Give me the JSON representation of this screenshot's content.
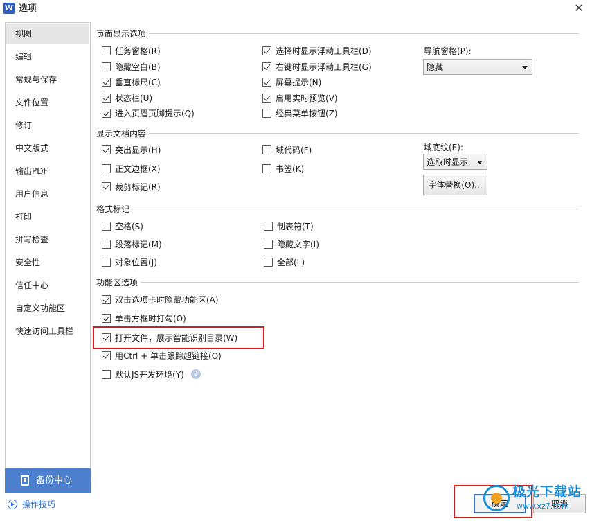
{
  "window": {
    "app_icon": "W",
    "title": "选项",
    "close": "✕"
  },
  "sidebar": {
    "items": [
      {
        "label": "视图",
        "active": true
      },
      {
        "label": "编辑"
      },
      {
        "label": "常规与保存"
      },
      {
        "label": "文件位置"
      },
      {
        "label": "修订"
      },
      {
        "label": "中文版式"
      },
      {
        "label": "输出PDF"
      },
      {
        "label": "用户信息"
      },
      {
        "label": "打印"
      },
      {
        "label": "拼写检查"
      },
      {
        "label": "安全性"
      },
      {
        "label": "信任中心"
      },
      {
        "label": "自定义功能区"
      },
      {
        "label": "快速访问工具栏"
      }
    ],
    "backup_label": "备份中心",
    "tips_label": "操作技巧"
  },
  "sections": {
    "page_display": {
      "title": "页面显示选项",
      "col1": [
        {
          "label": "任务窗格(R)",
          "checked": false
        },
        {
          "label": "隐藏空白(B)",
          "checked": false
        },
        {
          "label": "垂直标尺(C)",
          "checked": true
        },
        {
          "label": "状态栏(U)",
          "checked": true
        },
        {
          "label": "进入页眉页脚提示(Q)",
          "checked": true
        }
      ],
      "col2": [
        {
          "label": "选择时显示浮动工具栏(D)",
          "checked": true
        },
        {
          "label": "右键时显示浮动工具栏(G)",
          "checked": true
        },
        {
          "label": "屏幕提示(N)",
          "checked": true
        },
        {
          "label": "启用实时预览(V)",
          "checked": true
        },
        {
          "label": "经典菜单按钮(Z)",
          "checked": false
        }
      ],
      "nav_label": "导航窗格(P):",
      "nav_value": "隐藏"
    },
    "doc_content": {
      "title": "显示文档内容",
      "col1": [
        {
          "label": "突出显示(H)",
          "checked": true
        },
        {
          "label": "正文边框(X)",
          "checked": false
        },
        {
          "label": "裁剪标记(R)",
          "checked": true
        }
      ],
      "col2": [
        {
          "label": "域代码(F)",
          "checked": false
        },
        {
          "label": "书签(K)",
          "checked": false
        }
      ],
      "shading_label": "域底纹(E):",
      "shading_value": "选取时显示",
      "font_replace": "字体替换(O)..."
    },
    "format_marks": {
      "title": "格式标记",
      "col1": [
        {
          "label": "空格(S)",
          "checked": false
        },
        {
          "label": "段落标记(M)",
          "checked": false
        },
        {
          "label": "对象位置(J)",
          "checked": false
        }
      ],
      "col2": [
        {
          "label": "制表符(T)",
          "checked": false
        },
        {
          "label": "隐藏文字(I)",
          "checked": false
        },
        {
          "label": "全部(L)",
          "checked": false
        }
      ]
    },
    "ribbon": {
      "title": "功能区选项",
      "items": [
        {
          "label": "双击选项卡时隐藏功能区(A)",
          "checked": true
        },
        {
          "label": "单击方框时打勾(O)",
          "checked": true
        },
        {
          "label": "打开文件，展示智能识别目录(W)",
          "checked": true
        },
        {
          "label": "用Ctrl + 单击跟踪超链接(O)",
          "checked": true
        },
        {
          "label": "默认JS开发环境(Y)",
          "checked": false
        }
      ],
      "help": "?"
    }
  },
  "footer": {
    "ok": "确定",
    "cancel": "取消"
  },
  "watermark": {
    "text": "极光下载站",
    "url": "www.xz7.com"
  },
  "colors": {
    "accent": "#4d7fcf",
    "highlight": "#d21f1f",
    "link": "#2f6bd1"
  }
}
